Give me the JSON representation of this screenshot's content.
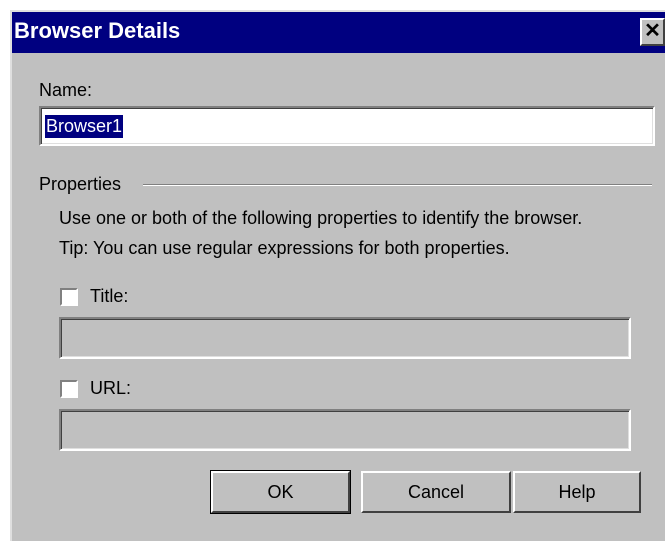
{
  "window": {
    "title": "Browser Details",
    "close_symbol": "✕"
  },
  "name": {
    "label": "Name:",
    "value": "Browser1"
  },
  "properties": {
    "group_label": "Properties",
    "description_line1": "Use one or both of the following properties to identify the browser.",
    "description_line2": "Tip: You can use regular expressions for both properties.",
    "title": {
      "label": "Title:",
      "checked": false,
      "value": ""
    },
    "url": {
      "label": "URL:",
      "checked": false,
      "value": ""
    }
  },
  "buttons": {
    "ok": "OK",
    "cancel": "Cancel",
    "help": "Help"
  },
  "colors": {
    "titlebar": "#000080",
    "face": "#c0c0c0",
    "selection": "#000080"
  }
}
